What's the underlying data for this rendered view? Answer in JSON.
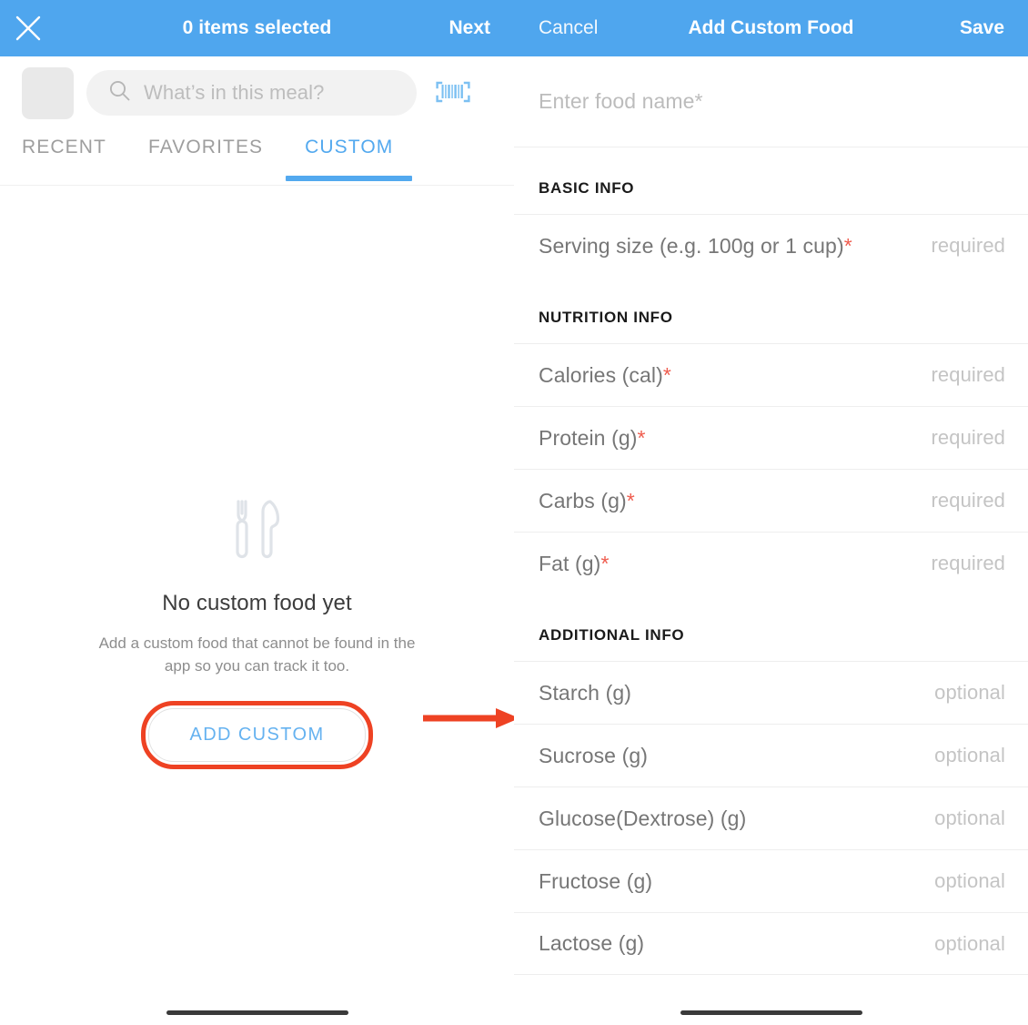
{
  "colors": {
    "brand_blue": "#4fa6ee",
    "tab_active": "#53a9ef",
    "link_blue": "#65b2f0",
    "annotation_red": "#ee4223",
    "required_star": "#ef5c4e",
    "muted_text": "#9e9e9e",
    "placeholder": "#bcbcbc"
  },
  "left_panel": {
    "navbar": {
      "close_icon": "close-x-icon",
      "title": "0 items selected",
      "next_label": "Next"
    },
    "search": {
      "icon": "search-icon",
      "placeholder": "What’s in this meal?",
      "value": "",
      "barcode_icon": "barcode-scan-icon",
      "thumbnail": "meal-thumbnail-placeholder"
    },
    "tabs": [
      {
        "label": "RECENT",
        "active": false
      },
      {
        "label": "FAVORITES",
        "active": false
      },
      {
        "label": "CUSTOM",
        "active": true
      }
    ],
    "empty_state": {
      "icon": "fork-and-knife-icon",
      "title": "No custom food yet",
      "subtitle": "Add a custom food that cannot be found in the app so you can track it too.",
      "button_label": "ADD CUSTOM"
    },
    "annotations": {
      "highlight_target": "ADD CUSTOM",
      "arrow": "right-arrow-annotation"
    }
  },
  "right_panel": {
    "navbar": {
      "cancel_label": "Cancel",
      "title": "Add Custom Food",
      "save_label": "Save"
    },
    "food_name": {
      "placeholder": "Enter food name*",
      "value": ""
    },
    "sections": [
      {
        "heading": "BASIC INFO",
        "rows": [
          {
            "label": "Serving size (e.g. 100g or 1 cup)",
            "required": true,
            "hint": "required",
            "value": ""
          }
        ]
      },
      {
        "heading": "NUTRITION INFO",
        "rows": [
          {
            "label": "Calories (cal)",
            "required": true,
            "hint": "required",
            "value": ""
          },
          {
            "label": "Protein (g)",
            "required": true,
            "hint": "required",
            "value": ""
          },
          {
            "label": "Carbs (g)",
            "required": true,
            "hint": "required",
            "value": ""
          },
          {
            "label": "Fat (g)",
            "required": true,
            "hint": "required",
            "value": ""
          }
        ]
      },
      {
        "heading": "ADDITIONAL INFO",
        "rows": [
          {
            "label": "Starch (g)",
            "required": false,
            "hint": "optional",
            "value": ""
          },
          {
            "label": "Sucrose (g)",
            "required": false,
            "hint": "optional",
            "value": ""
          },
          {
            "label": "Glucose(Dextrose) (g)",
            "required": false,
            "hint": "optional",
            "value": ""
          },
          {
            "label": "Fructose (g)",
            "required": false,
            "hint": "optional",
            "value": ""
          },
          {
            "label": "Lactose (g)",
            "required": false,
            "hint": "optional",
            "value": ""
          }
        ]
      }
    ]
  }
}
